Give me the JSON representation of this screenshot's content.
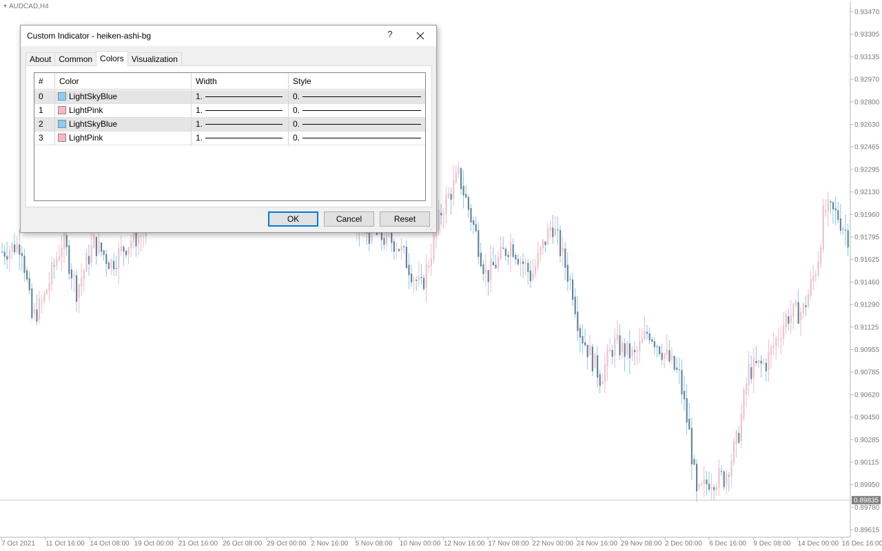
{
  "chart": {
    "symbol_title": "AUDCAD,H4",
    "current_price": "0.89835",
    "price_axis_labels": [
      "0.93470",
      "0.93305",
      "0.93135",
      "0.92970",
      "0.92800",
      "0.92630",
      "0.92465",
      "0.92295",
      "0.92130",
      "0.91960",
      "0.91795",
      "0.91625",
      "0.91460",
      "0.91290",
      "0.91125",
      "0.90955",
      "0.90785",
      "0.90620",
      "0.90450",
      "0.90285",
      "0.90115",
      "0.89950",
      "0.89780",
      "0.89615"
    ],
    "time_axis_labels": [
      "7 Oct 2021",
      "11 Oct 16:00",
      "14 Oct 08:00",
      "19 Oct 00:00",
      "21 Oct 16:00",
      "26 Oct 08:00",
      "29 Oct 00:00",
      "2 Nov 16:00",
      "5 Nov 08:00",
      "10 Nov 00:00",
      "12 Nov 16:00",
      "17 Nov 08:00",
      "22 Nov 00:00",
      "24 Nov 16:00",
      "29 Nov 08:00",
      "2 Dec 00:00",
      "6 Dec 16:00",
      "9 Dec 08:00",
      "14 Dec 00:00",
      "16 Dec 16:00"
    ],
    "colors": {
      "bull_body": "#e8c4cc",
      "bull_wick": "#f0b8c4",
      "bear_body": "#6a8496",
      "bear_wick": "#87c4e6",
      "axis_text": "#7a7a7a",
      "price_tag_bg": "#7f7f7f",
      "price_line": "#c8c8c8"
    }
  },
  "dialog": {
    "title": "Custom Indicator - heiken-ashi-bg",
    "help_label": "?",
    "close_icon": "close-icon",
    "tabs": [
      {
        "label": "About",
        "active": false
      },
      {
        "label": "Common",
        "active": false
      },
      {
        "label": "Colors",
        "active": true
      },
      {
        "label": "Visualization",
        "active": false
      }
    ],
    "grid": {
      "headers": {
        "index": "#",
        "color": "Color",
        "width": "Width",
        "style": "Style"
      },
      "rows": [
        {
          "index": "0",
          "color_name": "LightSkyBlue",
          "swatch": "#87cefa",
          "width": "1.",
          "style": "0."
        },
        {
          "index": "1",
          "color_name": "LightPink",
          "swatch": "#ffb6c1",
          "width": "1.",
          "style": "0."
        },
        {
          "index": "2",
          "color_name": "LightSkyBlue",
          "swatch": "#87cefa",
          "width": "1.",
          "style": "0."
        },
        {
          "index": "3",
          "color_name": "LightPink",
          "swatch": "#ffb6c1",
          "width": "1.",
          "style": "0."
        }
      ]
    },
    "buttons": {
      "ok": "OK",
      "cancel": "Cancel",
      "reset": "Reset"
    }
  }
}
